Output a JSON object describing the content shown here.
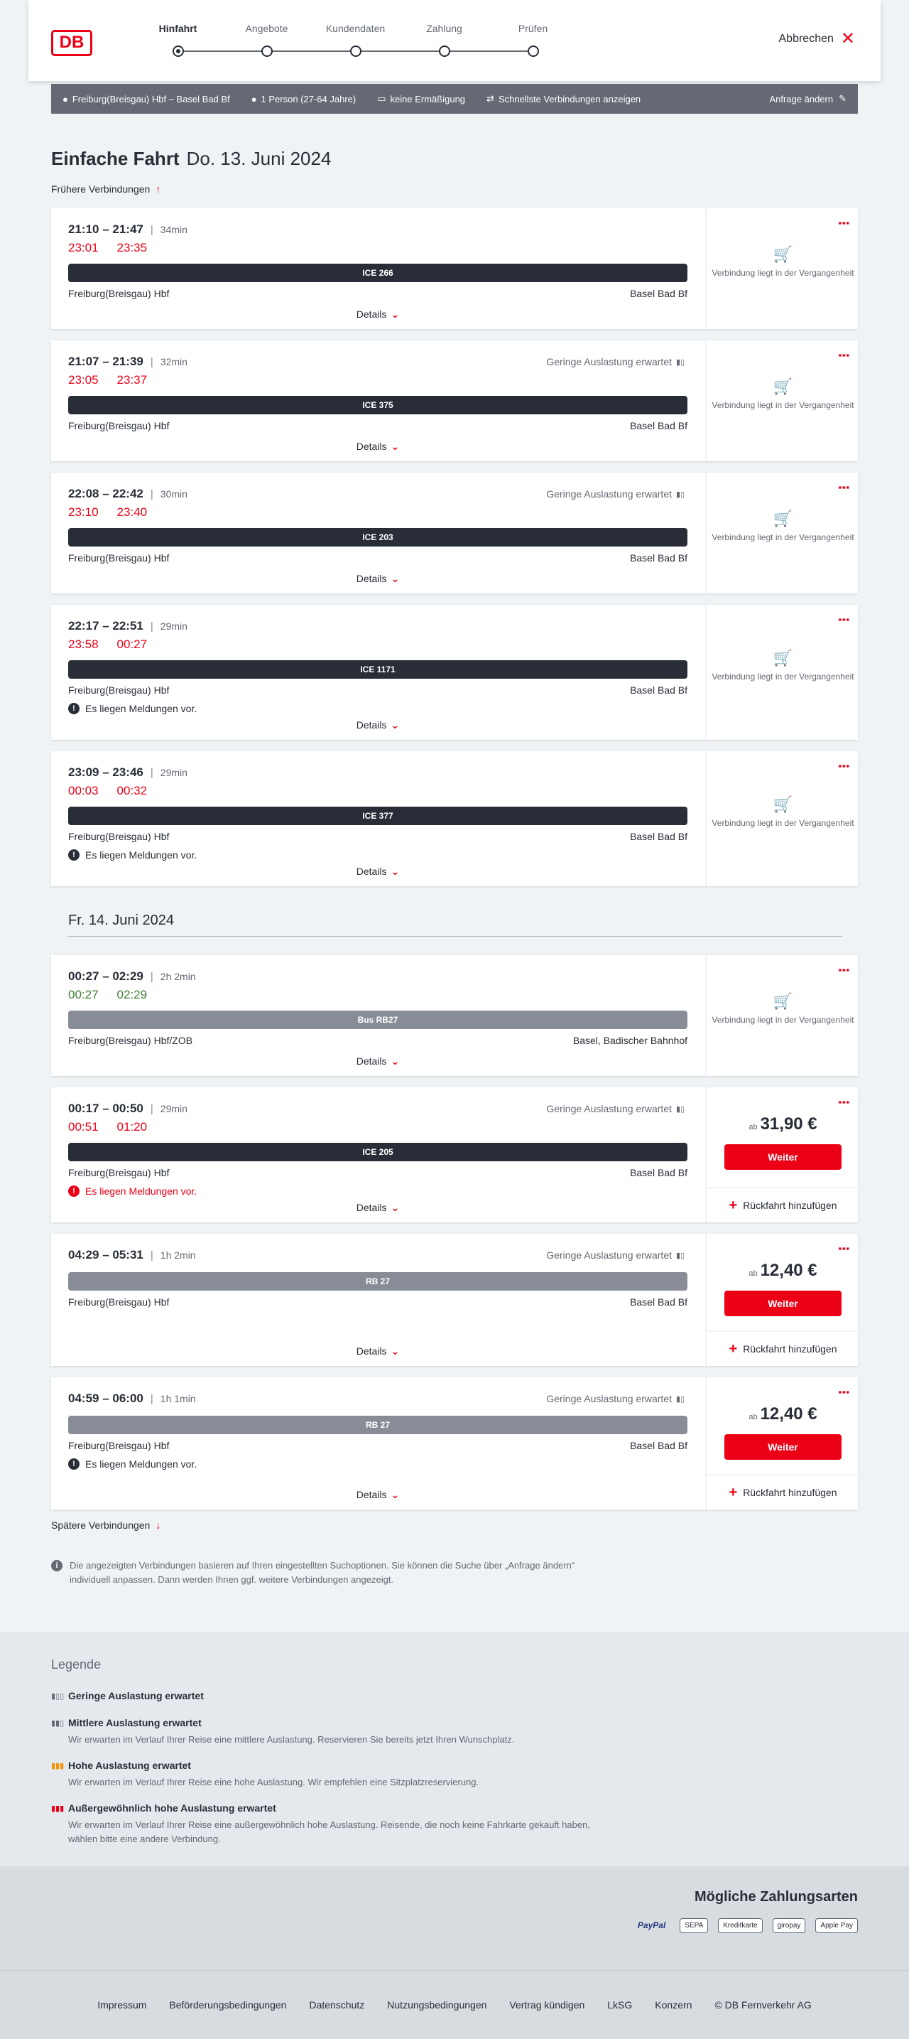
{
  "header": {
    "logo": "DB",
    "steps": [
      "Hinfahrt",
      "Angebote",
      "Kundendaten",
      "Zahlung",
      "Prüfen"
    ],
    "abort": "Abbrechen"
  },
  "summary": {
    "route": "Freiburg(Breisgau) Hbf – Basel Bad Bf",
    "persons": "1 Person (27-64 Jahre)",
    "discount": "keine Ermäßigung",
    "fastest": "Schnellste Verbindungen anzeigen",
    "change": "Anfrage ändern"
  },
  "heading": {
    "title": "Einfache Fahrt",
    "date": "Do. 13. Juni 2024"
  },
  "earlier": "Frühere Verbindungen",
  "later": "Spätere Verbindungen",
  "details": "Details",
  "past": "Verbindung liegt in der Vergangenheit",
  "load_text": "Geringe Auslastung erwartet",
  "price_prefix": "ab",
  "weiter": "Weiter",
  "return": "Rückfahrt hinzufügen",
  "msg": "Es liegen Meldungen vor.",
  "day2": "Fr. 14. Juni 2024",
  "connections": [
    {
      "times": "21:10 – 21:47",
      "dur": "34min",
      "rt_dep": "23:01",
      "rt_arr": "23:35",
      "train": "ICE 266",
      "from": "Freiburg(Breisgau) Hbf",
      "to": "Basel Bad Bf"
    },
    {
      "times": "21:07 – 21:39",
      "dur": "32min",
      "rt_dep": "23:05",
      "rt_arr": "23:37",
      "train": "ICE 375",
      "from": "Freiburg(Breisgau) Hbf",
      "to": "Basel Bad Bf"
    },
    {
      "times": "22:08 – 22:42",
      "dur": "30min",
      "rt_dep": "23:10",
      "rt_arr": "23:40",
      "train": "ICE 203",
      "from": "Freiburg(Breisgau) Hbf",
      "to": "Basel Bad Bf"
    },
    {
      "times": "22:17 – 22:51",
      "dur": "29min",
      "rt_dep": "23:58",
      "rt_arr": "00:27",
      "train": "ICE 1171",
      "from": "Freiburg(Breisgau) Hbf",
      "to": "Basel Bad Bf"
    },
    {
      "times": "23:09 – 23:46",
      "dur": "29min",
      "rt_dep": "00:03",
      "rt_arr": "00:32",
      "train": "ICE 377",
      "from": "Freiburg(Breisgau) Hbf",
      "to": "Basel Bad Bf"
    },
    {
      "times": "00:27 – 02:29",
      "dur": "2h 2min",
      "rt_dep": "00:27",
      "rt_arr": "02:29",
      "train": "Bus RB27",
      "from": "Freiburg(Breisgau) Hbf/ZOB",
      "to": "Basel, Badischer Bahnhof"
    },
    {
      "times": "00:17 – 00:50",
      "dur": "29min",
      "rt_dep": "00:51",
      "rt_arr": "01:20",
      "train": "ICE 205",
      "from": "Freiburg(Breisgau) Hbf",
      "to": "Basel Bad Bf",
      "price": "31,90 €"
    },
    {
      "times": "04:29 – 05:31",
      "dur": "1h 2min",
      "train": "RB 27",
      "from": "Freiburg(Breisgau) Hbf",
      "to": "Basel Bad Bf",
      "price": "12,40 €"
    },
    {
      "times": "04:59 – 06:00",
      "dur": "1h 1min",
      "train": "RB 27",
      "from": "Freiburg(Breisgau) Hbf",
      "to": "Basel Bad Bf",
      "price": "12,40 €"
    }
  ],
  "info": "Die angezeigten Verbindungen basieren auf Ihren eingestellten Suchoptionen. Sie können die Suche über „Anfrage ändern“ individuell anpassen. Dann werden Ihnen ggf. weitere Verbindungen angezeigt.",
  "legend": {
    "title": "Legende",
    "items": [
      {
        "h": "Geringe Auslastung erwartet",
        "d": ""
      },
      {
        "h": "Mittlere Auslastung erwartet",
        "d": "Wir erwarten im Verlauf Ihrer Reise eine mittlere Auslastung. Reservieren Sie bereits jetzt Ihren Wunschplatz."
      },
      {
        "h": "Hohe Auslastung erwartet",
        "d": "Wir erwarten im Verlauf Ihrer Reise eine hohe Auslastung. Wir empfehlen eine Sitzplatzreservierung."
      },
      {
        "h": "Außergewöhnlich hohe Auslastung erwartet",
        "d": "Wir erwarten im Verlauf Ihrer Reise eine außergewöhnlich hohe Auslastung. Reisende, die noch keine Fahrkarte gekauft haben, wählen bitte eine andere Verbindung."
      }
    ]
  },
  "payment": {
    "title": "Mögliche Zahlungsarten",
    "methods": [
      "PayPal",
      "SEPA",
      "Kreditkarte",
      "giropay",
      "Apple Pay"
    ]
  },
  "footer": [
    "Impressum",
    "Beförderungsbedingungen",
    "Datenschutz",
    "Nutzungsbedingungen",
    "Vertrag kündigen",
    "LkSG",
    "Konzern",
    "© DB Fernverkehr AG"
  ],
  "colors": {
    "red": "#ec0016",
    "dark": "#282d37",
    "grey": "#878c96",
    "bg": "#eff3f6",
    "green": "#408335"
  }
}
